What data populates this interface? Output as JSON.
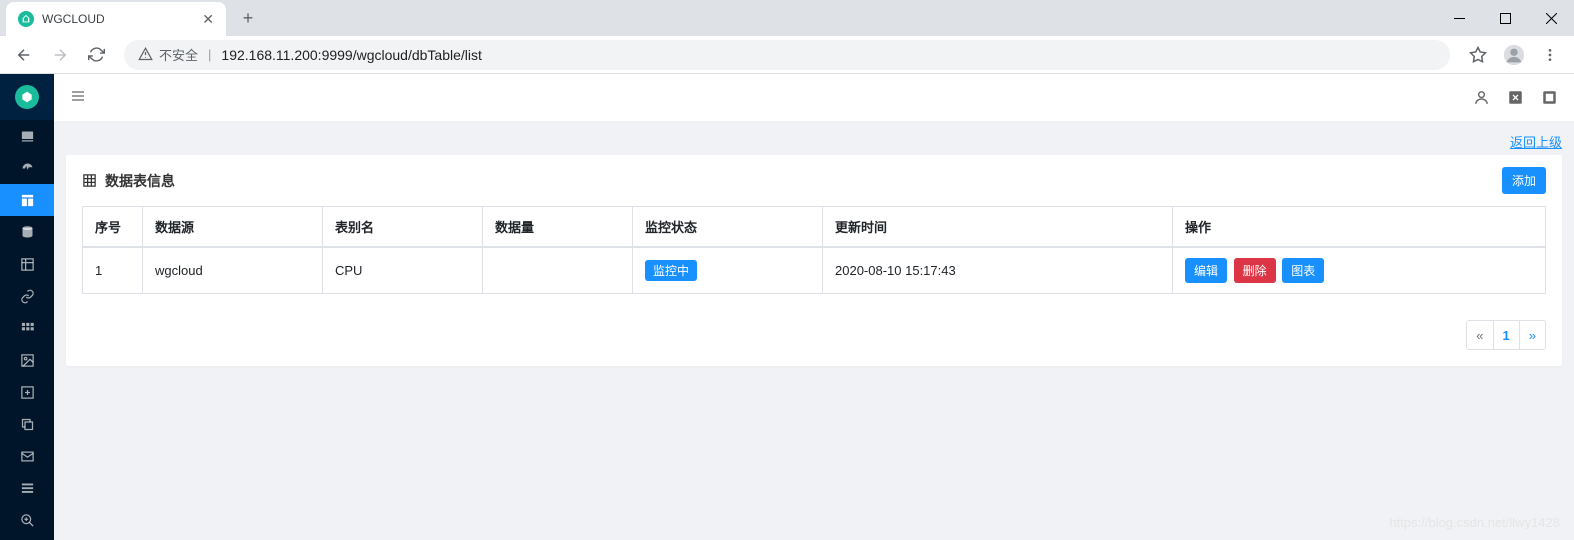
{
  "browser": {
    "tab_title": "WGCLOUD",
    "security_label": "不安全",
    "url": "192.168.11.200:9999/wgcloud/dbTable/list"
  },
  "page": {
    "return_link": "返回上级",
    "card_title": "数据表信息",
    "add_button": "添加"
  },
  "table": {
    "headers": {
      "seq": "序号",
      "datasource": "数据源",
      "alias": "表别名",
      "count": "数据量",
      "status": "监控状态",
      "updated": "更新时间",
      "action": "操作"
    },
    "rows": [
      {
        "seq": "1",
        "datasource": "wgcloud",
        "alias": "CPU",
        "count": "",
        "status": "监控中",
        "updated": "2020-08-10 15:17:43"
      }
    ],
    "actions": {
      "edit": "编辑",
      "delete": "删除",
      "chart": "图表"
    }
  },
  "pagination": {
    "prev": "«",
    "current": "1",
    "next": "»"
  },
  "watermark": "https://blog.csdn.net/llwy1428"
}
